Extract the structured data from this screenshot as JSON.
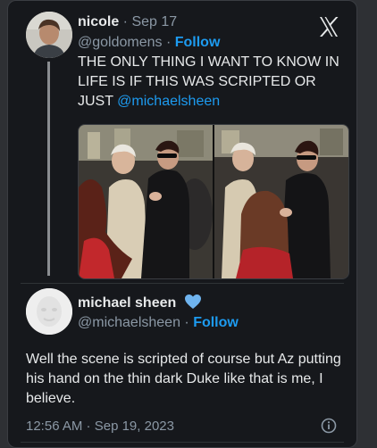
{
  "quoted": {
    "name": "nicole",
    "separator": " · ",
    "date": "Sep 17",
    "handle": "@goldomens",
    "follow_separator": " · ",
    "follow_label": "Follow",
    "text": "THE ONLY THING I WANT TO KNOW IN LIFE IS IF THIS WAS SCRIPTED OR JUST",
    "mention": "@michaelsheen"
  },
  "reply": {
    "name": "michael sheen",
    "handle": "@michaelsheen",
    "follow_separator": " · ",
    "follow_label": "Follow",
    "text": "Well the scene is scripted of course but Az putting his hand on the thin dark Duke like that is me, I believe.",
    "time": "12:56 AM",
    "date_separator": " · ",
    "date": "Sep 19, 2023"
  },
  "icons": {
    "logo": "x-logo-icon",
    "verified": "verified-heart-badge-icon",
    "info": "info-icon"
  },
  "colors": {
    "background": "#16181c",
    "link": "#1d9bf0",
    "verified_heart": "#6fb4ef",
    "text": "#e7e9ea",
    "muted": "#8b98a5"
  }
}
